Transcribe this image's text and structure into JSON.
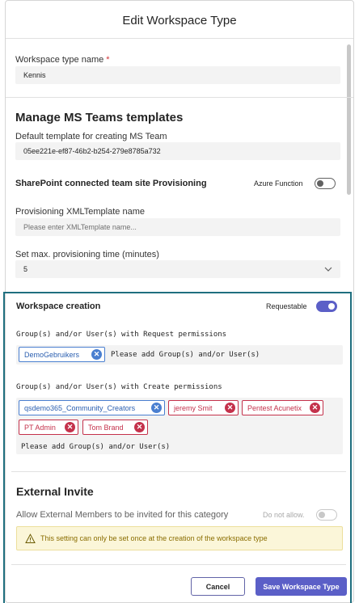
{
  "dialog": {
    "title": "Edit Workspace Type"
  },
  "workspace_type_name": {
    "label": "Workspace type name",
    "required_marker": "*",
    "value": "Kennis"
  },
  "teams_templates": {
    "heading": "Manage MS Teams templates",
    "default_template_label": "Default template for creating MS Team",
    "default_template_value": "05ee221e-ef87-46b2-b254-279e8785a732"
  },
  "sharepoint": {
    "label": "SharePoint connected team site Provisioning",
    "toggle_label": "Azure Function",
    "toggle_on": false
  },
  "xml_template": {
    "label": "Provisioning XMLTemplate name",
    "placeholder": "Please enter XMLTemplate name..."
  },
  "max_time": {
    "label": "Set max. provisioning time (minutes)",
    "value": "5"
  },
  "workspace_creation": {
    "label": "Workspace creation",
    "toggle_label": "Requestable",
    "toggle_on": true,
    "request_permissions_label": "Group(s) and/or User(s) with Request permissions",
    "request_chips": [
      {
        "text": "DemoGebruikers",
        "kind": "group"
      }
    ],
    "request_placeholder": "Please add Group(s) and/or User(s)",
    "create_permissions_label": "Group(s) and/or User(s) with Create permissions",
    "create_chips": [
      {
        "text": "qsdemo365_Community_Creators",
        "kind": "group"
      },
      {
        "text": "jeremy Smit",
        "kind": "user"
      },
      {
        "text": "Pentest Acunetix",
        "kind": "user"
      },
      {
        "text": "PT Admin",
        "kind": "user"
      },
      {
        "text": "Tom Brand",
        "kind": "user"
      }
    ],
    "create_placeholder": "Please add Group(s) and/or User(s)"
  },
  "external_invite": {
    "heading": "External Invite",
    "allow_label": "Allow External Members to be invited for this category",
    "toggle_label": "Do not allow.",
    "toggle_on": false,
    "warning": "This setting can only be set once at the creation of the workspace type"
  },
  "footer": {
    "cancel_label": "Cancel",
    "save_label": "Save Workspace Type"
  },
  "colors": {
    "accent": "#5b5fc7",
    "group_chip": "#4a7fd0",
    "user_chip": "#c4314b",
    "highlight_border": "#1f6f7f",
    "warning_bg": "#fbf6d9"
  },
  "icons": {
    "chevron": "chevron-down-icon",
    "remove": "remove-chip-icon",
    "warning": "warning-triangle-icon"
  }
}
